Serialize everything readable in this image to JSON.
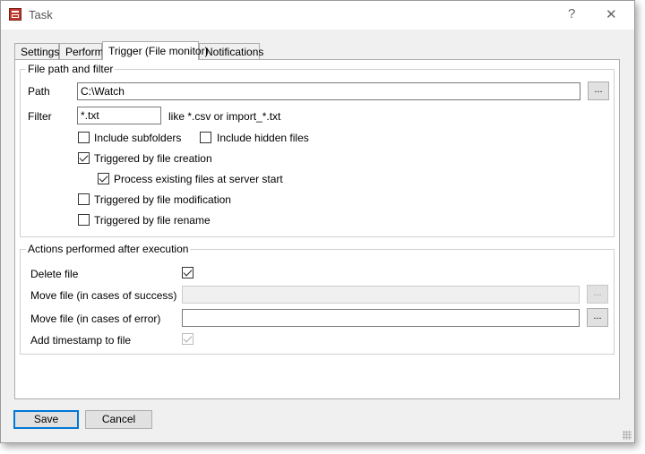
{
  "window": {
    "title": "Task",
    "help_glyph": "?",
    "close_glyph": "✕"
  },
  "tabs": [
    "Settings",
    "Perform",
    "Trigger (File monitor)",
    "Notifications"
  ],
  "file_group": {
    "title": "File path and filter",
    "path_label": "Path",
    "path_value": "C:\\Watch",
    "browse_label": "...",
    "filter_label": "Filter",
    "filter_value": "*.txt",
    "filter_hint": "like *.csv or import_*.txt",
    "include_subfolders": {
      "label": "Include subfolders",
      "checked": false
    },
    "include_hidden": {
      "label": "Include hidden files",
      "checked": false
    },
    "triggered_creation": {
      "label": "Triggered by file creation",
      "checked": true
    },
    "process_existing": {
      "label": "Process existing files at server start",
      "checked": true
    },
    "triggered_modification": {
      "label": "Triggered by file modification",
      "checked": false
    },
    "triggered_rename": {
      "label": "Triggered by file rename",
      "checked": false
    }
  },
  "actions_group": {
    "title": "Actions performed after execution",
    "delete_file": {
      "label": "Delete file",
      "checked": true
    },
    "move_success": {
      "label": "Move file (in cases of success)",
      "value": ""
    },
    "move_error": {
      "label": "Move file (in cases of error)",
      "value": ""
    },
    "add_timestamp": {
      "label": "Add timestamp to file",
      "checked": true
    },
    "browse_label": "..."
  },
  "footer": {
    "save_label": "Save",
    "cancel_label": "Cancel"
  }
}
